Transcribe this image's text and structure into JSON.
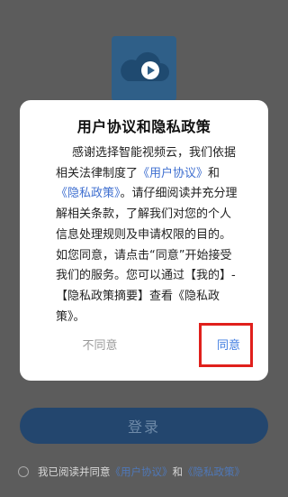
{
  "background": {
    "login_button_label": "登录",
    "agreement": {
      "prefix": "我已阅读并同意",
      "user_agreement": "《用户协议》",
      "and": "和",
      "privacy_policy": "《隐私政策》"
    }
  },
  "dialog": {
    "title": "用户协议和隐私政策",
    "body": {
      "part1": "感谢选择智能视频云，我们依据相关法律制度了",
      "link1": "《用户协议》",
      "part2": "和",
      "link2": "《隐私政策》",
      "part3": "。请仔细阅读并充分理解相关条款，了解我们对您的个人信息处理规则及申请权限的目的。如您同意，请点击“同意”开始接受我们的服务。您可以通过【我的】-【隐私政策摘要】查看《隐私政策》。"
    },
    "disagree_label": "不同意",
    "agree_label": "同意"
  },
  "colors": {
    "accent_link": "#3f6fd0",
    "agree_button": "#3f7ce0",
    "highlight": "#e0201c"
  }
}
